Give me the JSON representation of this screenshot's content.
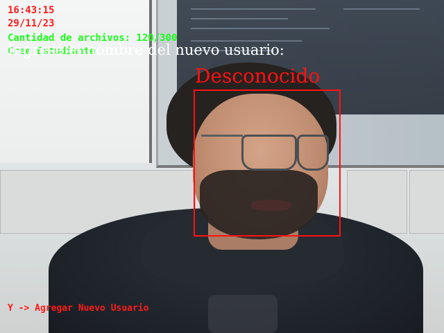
{
  "overlay": {
    "time": "16:43:15",
    "date": "29/11/23",
    "file_count": "Cantidad de archivos: 120/300",
    "ghost_text": "Cree Estudiante",
    "prompt": "Ingrese el nombre del nuevo usuario:",
    "face_label": "Desconocido",
    "instruction": "Y -> Agregar Nuevo Usuario"
  },
  "colors": {
    "status_red": "#ff1a1a",
    "status_green": "#1aff1a",
    "face_box": "#ff1111",
    "prompt_text": "#ffffff"
  }
}
